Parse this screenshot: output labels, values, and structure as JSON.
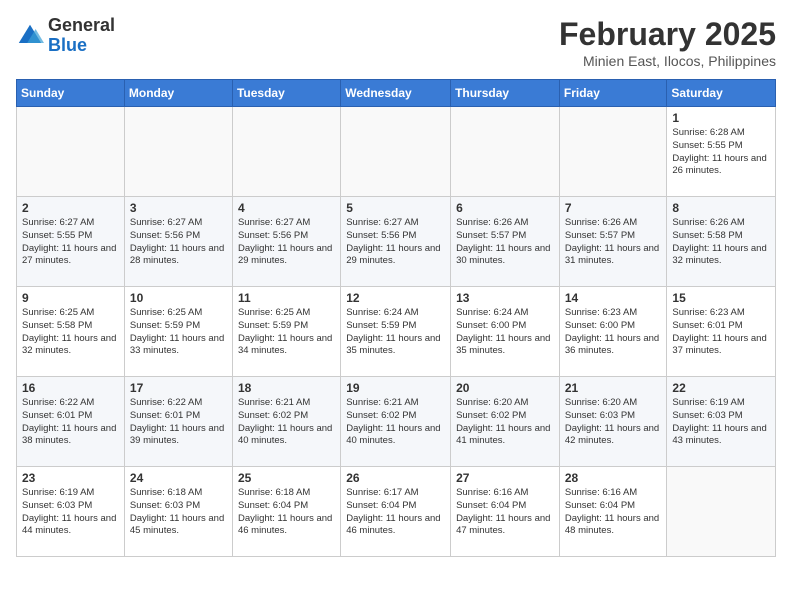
{
  "header": {
    "logo": {
      "general": "General",
      "blue": "Blue"
    },
    "month_year": "February 2025",
    "location": "Minien East, Ilocos, Philippines"
  },
  "weekdays": [
    "Sunday",
    "Monday",
    "Tuesday",
    "Wednesday",
    "Thursday",
    "Friday",
    "Saturday"
  ],
  "weeks": [
    [
      {
        "day": "",
        "info": ""
      },
      {
        "day": "",
        "info": ""
      },
      {
        "day": "",
        "info": ""
      },
      {
        "day": "",
        "info": ""
      },
      {
        "day": "",
        "info": ""
      },
      {
        "day": "",
        "info": ""
      },
      {
        "day": "1",
        "info": "Sunrise: 6:28 AM\nSunset: 5:55 PM\nDaylight: 11 hours and 26 minutes."
      }
    ],
    [
      {
        "day": "2",
        "info": "Sunrise: 6:27 AM\nSunset: 5:55 PM\nDaylight: 11 hours and 27 minutes."
      },
      {
        "day": "3",
        "info": "Sunrise: 6:27 AM\nSunset: 5:56 PM\nDaylight: 11 hours and 28 minutes."
      },
      {
        "day": "4",
        "info": "Sunrise: 6:27 AM\nSunset: 5:56 PM\nDaylight: 11 hours and 29 minutes."
      },
      {
        "day": "5",
        "info": "Sunrise: 6:27 AM\nSunset: 5:56 PM\nDaylight: 11 hours and 29 minutes."
      },
      {
        "day": "6",
        "info": "Sunrise: 6:26 AM\nSunset: 5:57 PM\nDaylight: 11 hours and 30 minutes."
      },
      {
        "day": "7",
        "info": "Sunrise: 6:26 AM\nSunset: 5:57 PM\nDaylight: 11 hours and 31 minutes."
      },
      {
        "day": "8",
        "info": "Sunrise: 6:26 AM\nSunset: 5:58 PM\nDaylight: 11 hours and 32 minutes."
      }
    ],
    [
      {
        "day": "9",
        "info": "Sunrise: 6:25 AM\nSunset: 5:58 PM\nDaylight: 11 hours and 32 minutes."
      },
      {
        "day": "10",
        "info": "Sunrise: 6:25 AM\nSunset: 5:59 PM\nDaylight: 11 hours and 33 minutes."
      },
      {
        "day": "11",
        "info": "Sunrise: 6:25 AM\nSunset: 5:59 PM\nDaylight: 11 hours and 34 minutes."
      },
      {
        "day": "12",
        "info": "Sunrise: 6:24 AM\nSunset: 5:59 PM\nDaylight: 11 hours and 35 minutes."
      },
      {
        "day": "13",
        "info": "Sunrise: 6:24 AM\nSunset: 6:00 PM\nDaylight: 11 hours and 35 minutes."
      },
      {
        "day": "14",
        "info": "Sunrise: 6:23 AM\nSunset: 6:00 PM\nDaylight: 11 hours and 36 minutes."
      },
      {
        "day": "15",
        "info": "Sunrise: 6:23 AM\nSunset: 6:01 PM\nDaylight: 11 hours and 37 minutes."
      }
    ],
    [
      {
        "day": "16",
        "info": "Sunrise: 6:22 AM\nSunset: 6:01 PM\nDaylight: 11 hours and 38 minutes."
      },
      {
        "day": "17",
        "info": "Sunrise: 6:22 AM\nSunset: 6:01 PM\nDaylight: 11 hours and 39 minutes."
      },
      {
        "day": "18",
        "info": "Sunrise: 6:21 AM\nSunset: 6:02 PM\nDaylight: 11 hours and 40 minutes."
      },
      {
        "day": "19",
        "info": "Sunrise: 6:21 AM\nSunset: 6:02 PM\nDaylight: 11 hours and 40 minutes."
      },
      {
        "day": "20",
        "info": "Sunrise: 6:20 AM\nSunset: 6:02 PM\nDaylight: 11 hours and 41 minutes."
      },
      {
        "day": "21",
        "info": "Sunrise: 6:20 AM\nSunset: 6:03 PM\nDaylight: 11 hours and 42 minutes."
      },
      {
        "day": "22",
        "info": "Sunrise: 6:19 AM\nSunset: 6:03 PM\nDaylight: 11 hours and 43 minutes."
      }
    ],
    [
      {
        "day": "23",
        "info": "Sunrise: 6:19 AM\nSunset: 6:03 PM\nDaylight: 11 hours and 44 minutes."
      },
      {
        "day": "24",
        "info": "Sunrise: 6:18 AM\nSunset: 6:03 PM\nDaylight: 11 hours and 45 minutes."
      },
      {
        "day": "25",
        "info": "Sunrise: 6:18 AM\nSunset: 6:04 PM\nDaylight: 11 hours and 46 minutes."
      },
      {
        "day": "26",
        "info": "Sunrise: 6:17 AM\nSunset: 6:04 PM\nDaylight: 11 hours and 46 minutes."
      },
      {
        "day": "27",
        "info": "Sunrise: 6:16 AM\nSunset: 6:04 PM\nDaylight: 11 hours and 47 minutes."
      },
      {
        "day": "28",
        "info": "Sunrise: 6:16 AM\nSunset: 6:04 PM\nDaylight: 11 hours and 48 minutes."
      },
      {
        "day": "",
        "info": ""
      }
    ]
  ]
}
